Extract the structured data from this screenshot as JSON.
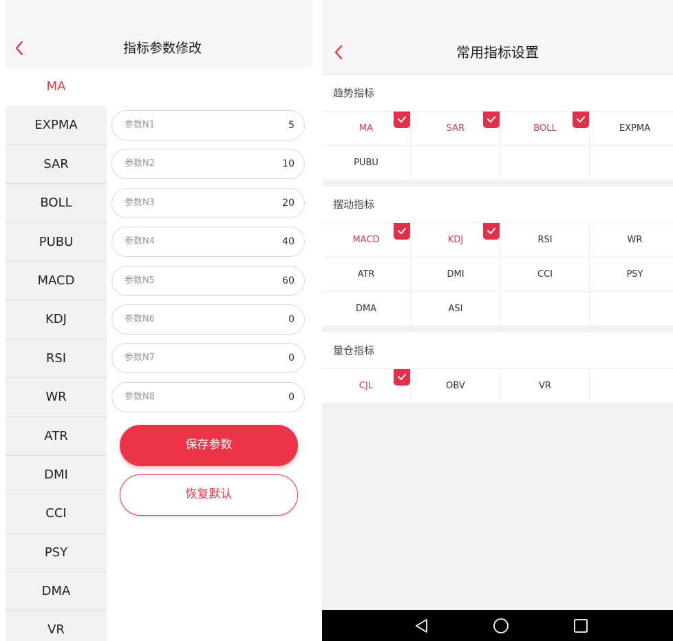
{
  "left_screen": {
    "header": {
      "title": "指标参数修改"
    },
    "indicators": [
      {
        "label": "MA",
        "active": true
      },
      {
        "label": "EXPMA"
      },
      {
        "label": "SAR"
      },
      {
        "label": "BOLL"
      },
      {
        "label": "PUBU"
      },
      {
        "label": "MACD"
      },
      {
        "label": "KDJ"
      },
      {
        "label": "RSI"
      },
      {
        "label": "WR"
      },
      {
        "label": "ATR"
      },
      {
        "label": "DMI"
      },
      {
        "label": "CCI"
      },
      {
        "label": "PSY"
      },
      {
        "label": "DMA"
      },
      {
        "label": "VR"
      }
    ],
    "params": [
      {
        "label": "参数N1",
        "value": "5"
      },
      {
        "label": "参数N2",
        "value": "10"
      },
      {
        "label": "参数N3",
        "value": "20"
      },
      {
        "label": "参数N4",
        "value": "40"
      },
      {
        "label": "参数N5",
        "value": "60"
      },
      {
        "label": "参数N6",
        "value": "0"
      },
      {
        "label": "参数N7",
        "value": "0"
      },
      {
        "label": "参数N8",
        "value": "0"
      }
    ],
    "save_label": "保存参数",
    "reset_label": "恢复默认"
  },
  "right_screen": {
    "header": {
      "title": "常用指标设置"
    },
    "sections": [
      {
        "title": "趋势指标",
        "items": [
          {
            "label": "MA",
            "selected": true
          },
          {
            "label": "SAR",
            "selected": true
          },
          {
            "label": "BOLL",
            "selected": true
          },
          {
            "label": "EXPMA",
            "selected": false
          },
          {
            "label": "PUBU",
            "selected": false
          }
        ]
      },
      {
        "title": "摆动指标",
        "items": [
          {
            "label": "MACD",
            "selected": true
          },
          {
            "label": "KDJ",
            "selected": true
          },
          {
            "label": "RSI",
            "selected": false
          },
          {
            "label": "WR",
            "selected": false
          },
          {
            "label": "ATR",
            "selected": false
          },
          {
            "label": "DMI",
            "selected": false
          },
          {
            "label": "CCI",
            "selected": false
          },
          {
            "label": "PSY",
            "selected": false
          },
          {
            "label": "DMA",
            "selected": false
          },
          {
            "label": "ASI",
            "selected": false
          }
        ]
      },
      {
        "title": "量仓指标",
        "items": [
          {
            "label": "CJL",
            "selected": true
          },
          {
            "label": "OBV",
            "selected": false
          },
          {
            "label": "VR",
            "selected": false
          }
        ]
      }
    ],
    "nav": {
      "icons": [
        "back-triangle-icon",
        "home-circle-icon",
        "recents-square-icon"
      ]
    }
  },
  "colors": {
    "accent": "#ec3448",
    "selected_text": "#d83a4e",
    "list_bg": "#f2f2f2",
    "header_bg": "#f6f6f6"
  }
}
